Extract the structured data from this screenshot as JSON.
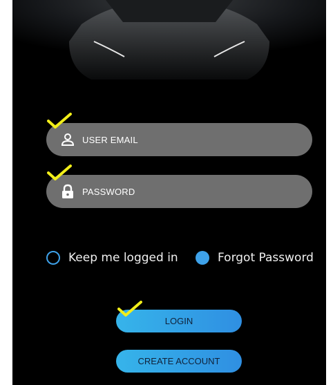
{
  "login_form": {
    "email": {
      "placeholder": "USER EMAIL",
      "icon": "user-icon"
    },
    "password": {
      "placeholder": "PASSWORD",
      "icon": "lock-icon"
    }
  },
  "options": {
    "remember_label": "Keep me logged in",
    "remember_checked": false,
    "forgot_label": "Forgot Password",
    "forgot_selected": true
  },
  "buttons": {
    "login_label": "LOGIN",
    "create_account_label": "CREATE ACCOUNT"
  },
  "annotations": {
    "checkmark_color": "#f2ee1a",
    "checkmark_icon": "check-icon"
  },
  "colors": {
    "accent": "#3ea2ea",
    "field_bg": "#6f6f6f",
    "background": "#000000"
  }
}
